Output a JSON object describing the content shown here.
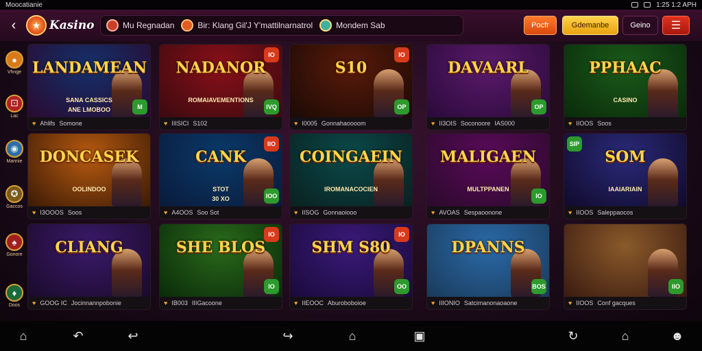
{
  "status": {
    "left": "Moocatianie",
    "right": "1:25 1:2 APH"
  },
  "header": {
    "back_icon": "chevron-left-icon",
    "logo_text": "Kasino",
    "pills": [
      {
        "label": "Mu Regnadan",
        "color": "#c8402a"
      },
      {
        "label": "Bir: Klang Gil'J Y'mattilnarnatrol",
        "color": "#e35b20"
      },
      {
        "label": "Mondem Sab",
        "color": "#3fb0a0"
      }
    ],
    "login_label": "Pocfr",
    "register_label": "Gdemanbe",
    "settings_label": "Geino",
    "menu_icon": "hamburger-icon"
  },
  "sidebar": {
    "items": [
      {
        "label": "Vhnge",
        "icon": "coin-icon",
        "color": "#d97a1a"
      },
      {
        "label": "Lac",
        "icon": "dice-icon",
        "color": "#b32020"
      },
      {
        "label": "Mannie",
        "icon": "chip-icon",
        "color": "#2a6fa8"
      },
      {
        "label": "Gaccos",
        "icon": "roulette-icon",
        "color": "#7a5a1a"
      },
      {
        "label": "Gonore",
        "icon": "cards-icon",
        "color": "#a02020"
      },
      {
        "label": "Doos",
        "icon": "table-icon",
        "color": "#1a6a3a"
      }
    ]
  },
  "games": [
    {
      "title": "LANDAMEAN",
      "subtitle": "SANA CASSICS",
      "tag": "ANE LMOBOO",
      "meta1": "Ahlifs",
      "meta2": "Somone",
      "bg": "#14306a",
      "bg2": "#2a0a30",
      "badge_br": "M"
    },
    {
      "title": "NADANOR",
      "subtitle": "ROMAIAVEMENTIONS",
      "tag": "",
      "meta1": "IIISICI",
      "meta2": "S102",
      "bg": "#8a1018",
      "bg2": "#3a0a10",
      "badge_tr": "IO",
      "badge_br": "IVQ"
    },
    {
      "title": "S10",
      "subtitle": "",
      "tag": "",
      "meta1": "I0005",
      "meta2": "Gonnahaoooom",
      "bg": "#5a1a0a",
      "bg2": "#1a0a05",
      "badge_tr": "IO",
      "badge_br": "OP"
    },
    {
      "title": "DAVAARL",
      "subtitle": "",
      "tag": "",
      "meta1": "II3OIS",
      "meta2": "Soconoore",
      "meta3": "IAS000",
      "bg": "#5a1a6a",
      "bg2": "#2a0a3a",
      "badge_br": "OP"
    },
    {
      "title": "PPHAAC",
      "subtitle": "CASINO",
      "tag": "",
      "meta1": "IIOOS",
      "meta2": "Soos",
      "bg": "#1a5a1a",
      "bg2": "#0a2a0a"
    },
    {
      "title": "DONCASEK",
      "subtitle": "OOLINDOO",
      "tag": "",
      "meta1": "I3OOOS",
      "meta2": "Soos",
      "bg": "#b85a10",
      "bg2": "#3a1a05"
    },
    {
      "title": "CANK",
      "subtitle": "STOT",
      "tag": "30 XO",
      "meta1": "A4OOS",
      "meta2": "Soo Sot",
      "bg": "#0a3a6a",
      "bg2": "#0a1a3a",
      "badge_tr": "IIO",
      "badge_br": "IOO"
    },
    {
      "title": "COINGAEIN",
      "subtitle": "IROMANACOCIEN",
      "tag": "",
      "meta1": "IISOG",
      "meta2": "Gonnaoiooo",
      "bg": "#0a4a4a",
      "bg2": "#0a2020"
    },
    {
      "title": "MALIGAEN",
      "subtitle": "MULTPPANEN",
      "tag": "",
      "meta1": "AVOAS",
      "meta2": "Sespaoonone",
      "bg": "#5a0a5a",
      "bg2": "#2a0a2a",
      "badge_br": "IO"
    },
    {
      "title": "SOM",
      "subtitle": "IAAIARIAIN",
      "tag": "",
      "meta1": "IIOOS",
      "meta2": "Saleppaocos",
      "bg": "#2a2a7a",
      "bg2": "#100a2a",
      "badge_tl": "SIP"
    },
    {
      "title": "CLIANG",
      "subtitle": "",
      "tag": "",
      "meta1": "GOOG IC",
      "meta2": "Jocinnannpobonie",
      "bg": "#3a1a6a",
      "bg2": "#1a0a2a"
    },
    {
      "title": "SHE BLOS",
      "subtitle": "",
      "tag": "",
      "meta1": "IB003",
      "meta2": "IIIGacoone",
      "bg": "#2a6a1a",
      "bg2": "#0a2a0a",
      "badge_tr": "IO",
      "badge_br": "IO"
    },
    {
      "title": "SHM S80",
      "subtitle": "",
      "tag": "",
      "meta1": "IIEOOC",
      "meta2": "Aburoboboioe",
      "bg": "#3a1a7a",
      "bg2": "#1a0a3a",
      "badge_tr": "IO",
      "badge_br": "OO"
    },
    {
      "title": "DPANNS",
      "subtitle": "",
      "tag": "",
      "meta1": "IIIONIO",
      "meta2": "Satcimanonaoaone",
      "bg": "#2a6aa8",
      "bg2": "#1a3a5a",
      "badge_br": "BOS"
    },
    {
      "title": "",
      "subtitle": "",
      "tag": "",
      "meta1": "IIOOS",
      "meta2": "Conf gacques",
      "bg": "#8a5a2a",
      "bg2": "#3a1a10",
      "badge_br": "IIO"
    }
  ],
  "nav": {
    "icons": [
      "home-icon",
      "back-icon",
      "undo-icon",
      "redo-icon",
      "home-outline-icon",
      "recents-icon",
      "rotate-icon",
      "house-icon",
      "user-icon"
    ]
  }
}
